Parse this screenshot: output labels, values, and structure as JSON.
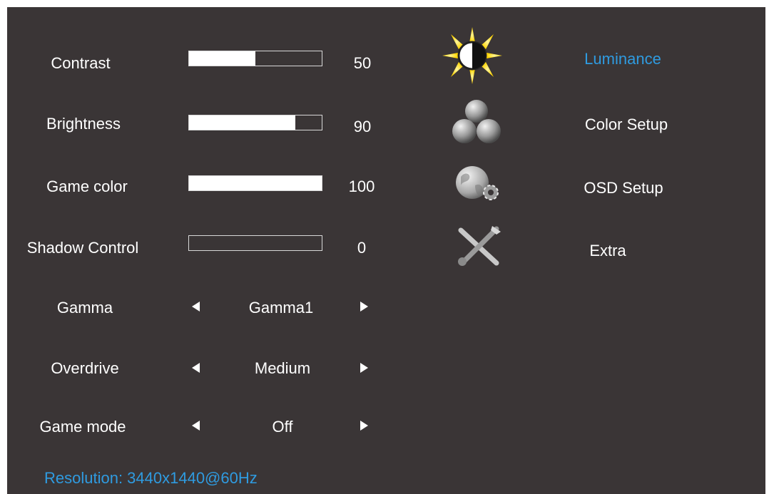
{
  "settings": {
    "contrast": {
      "label": "Contrast",
      "value": "50",
      "level": 0.5
    },
    "brightness": {
      "label": "Brightness",
      "value": "90",
      "level": 0.8
    },
    "game_color": {
      "label": "Game color",
      "value": "100",
      "level": 1.0
    },
    "shadow_control": {
      "label": "Shadow Control",
      "value": "0",
      "level": 0.0
    },
    "gamma": {
      "label": "Gamma",
      "value": "Gamma1"
    },
    "overdrive": {
      "label": "Overdrive",
      "value": "Medium"
    },
    "game_mode": {
      "label": "Game mode",
      "value": "Off"
    }
  },
  "menu": {
    "items": [
      {
        "label": "Luminance",
        "icon": "sun-icon",
        "active": true
      },
      {
        "label": "Color Setup",
        "icon": "color-spheres-icon",
        "active": false
      },
      {
        "label": "OSD Setup",
        "icon": "globe-gear-icon",
        "active": false
      },
      {
        "label": "Extra",
        "icon": "tools-icon",
        "active": false
      }
    ]
  },
  "status": {
    "resolution": "Resolution: 3440x1440@60Hz"
  },
  "colors": {
    "background": "#3a3536",
    "accent": "#2f9be0",
    "text": "#ffffff",
    "sun": "#ffd400"
  }
}
